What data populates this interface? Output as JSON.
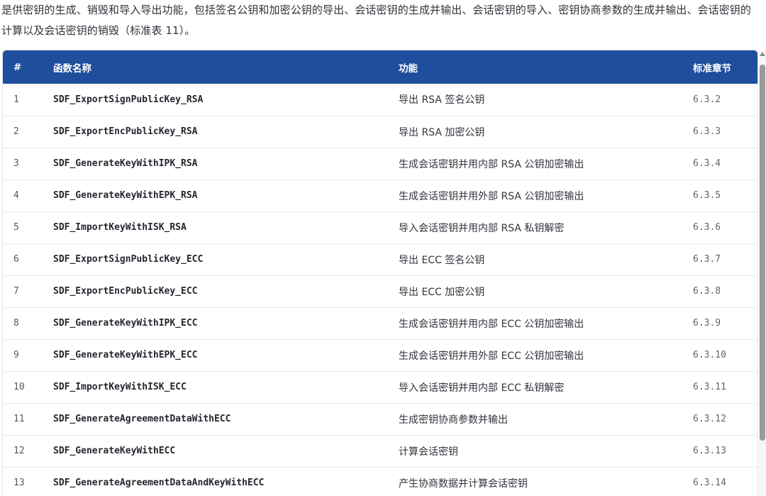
{
  "intro_text": "是供密钥的生成、销毁和导入导出功能，包括签名公钥和加密公钥的导出、会话密钥的生成并输出、会话密钥的导入、密钥协商参数的生成并输出、会话密钥的计算以及会话密钥的销毁（标准表 11）。",
  "table": {
    "headers": {
      "num": "#",
      "name": "函数名称",
      "func": "功能",
      "section": "标准章节"
    },
    "rows": [
      {
        "num": "1",
        "name": "SDF_ExportSignPublicKey_RSA",
        "func": "导出 RSA 签名公钥",
        "section": "6.3.2"
      },
      {
        "num": "2",
        "name": "SDF_ExportEncPublicKey_RSA",
        "func": "导出 RSA 加密公钥",
        "section": "6.3.3"
      },
      {
        "num": "3",
        "name": "SDF_GenerateKeyWithIPK_RSA",
        "func": "生成会话密钥并用内部 RSA 公钥加密输出",
        "section": "6.3.4"
      },
      {
        "num": "4",
        "name": "SDF_GenerateKeyWithEPK_RSA",
        "func": "生成会话密钥并用外部 RSA 公钥加密输出",
        "section": "6.3.5"
      },
      {
        "num": "5",
        "name": "SDF_ImportKeyWithISK_RSA",
        "func": "导入会话密钥并用内部 RSA 私钥解密",
        "section": "6.3.6"
      },
      {
        "num": "6",
        "name": "SDF_ExportSignPublicKey_ECC",
        "func": "导出 ECC 签名公钥",
        "section": "6.3.7"
      },
      {
        "num": "7",
        "name": "SDF_ExportEncPublicKey_ECC",
        "func": "导出 ECC 加密公钥",
        "section": "6.3.8"
      },
      {
        "num": "8",
        "name": "SDF_GenerateKeyWithIPK_ECC",
        "func": "生成会话密钥并用内部 ECC 公钥加密输出",
        "section": "6.3.9"
      },
      {
        "num": "9",
        "name": "SDF_GenerateKeyWithEPK_ECC",
        "func": "生成会话密钥并用外部 ECC 公钥加密输出",
        "section": "6.3.10"
      },
      {
        "num": "10",
        "name": "SDF_ImportKeyWithISK_ECC",
        "func": "导入会话密钥并用内部 ECC 私钥解密",
        "section": "6.3.11"
      },
      {
        "num": "11",
        "name": "SDF_GenerateAgreementDataWithECC",
        "func": "生成密钥协商参数并输出",
        "section": "6.3.12"
      },
      {
        "num": "12",
        "name": "SDF_GenerateKeyWithECC",
        "func": "计算会话密钥",
        "section": "6.3.13"
      },
      {
        "num": "13",
        "name": "SDF_GenerateAgreementDataAndKeyWithECC",
        "func": "产生协商数据并计算会话密钥",
        "section": "6.3.14"
      }
    ]
  },
  "colors": {
    "header_bg": "#1f4e9c",
    "header_text": "#ffffff",
    "row_border": "#e6e9ed"
  }
}
